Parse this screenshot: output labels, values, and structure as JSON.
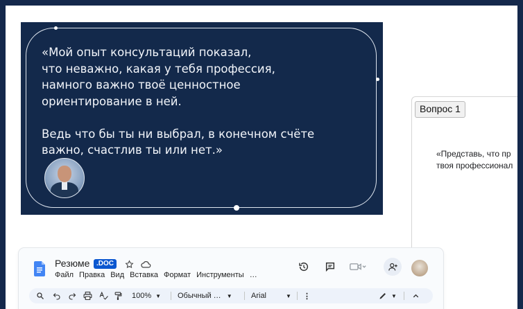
{
  "quote": {
    "text": "«Мой опыт консультаций показал,\nчто неважно, какая у тебя профессия,\nнамного важно твоё ценностное\nориентирование в ней.\n\nВедь что бы ты ни выбрал, в конечном счёте\nважно, счастлив ты или нет.»",
    "background": "#13294b"
  },
  "side_panel": {
    "question_label": "Вопрос 1",
    "text_line1": "«Представь, что пр",
    "text_line2": "твоя профессионал"
  },
  "docs": {
    "title": "Резюме",
    "badge": ".DOC",
    "menu": [
      "Файл",
      "Правка",
      "Вид",
      "Вставка",
      "Формат",
      "Инструменты",
      "…"
    ],
    "zoom": "100%",
    "style": "Обычный …",
    "font": "Arial",
    "accent": "#0b57d0"
  }
}
